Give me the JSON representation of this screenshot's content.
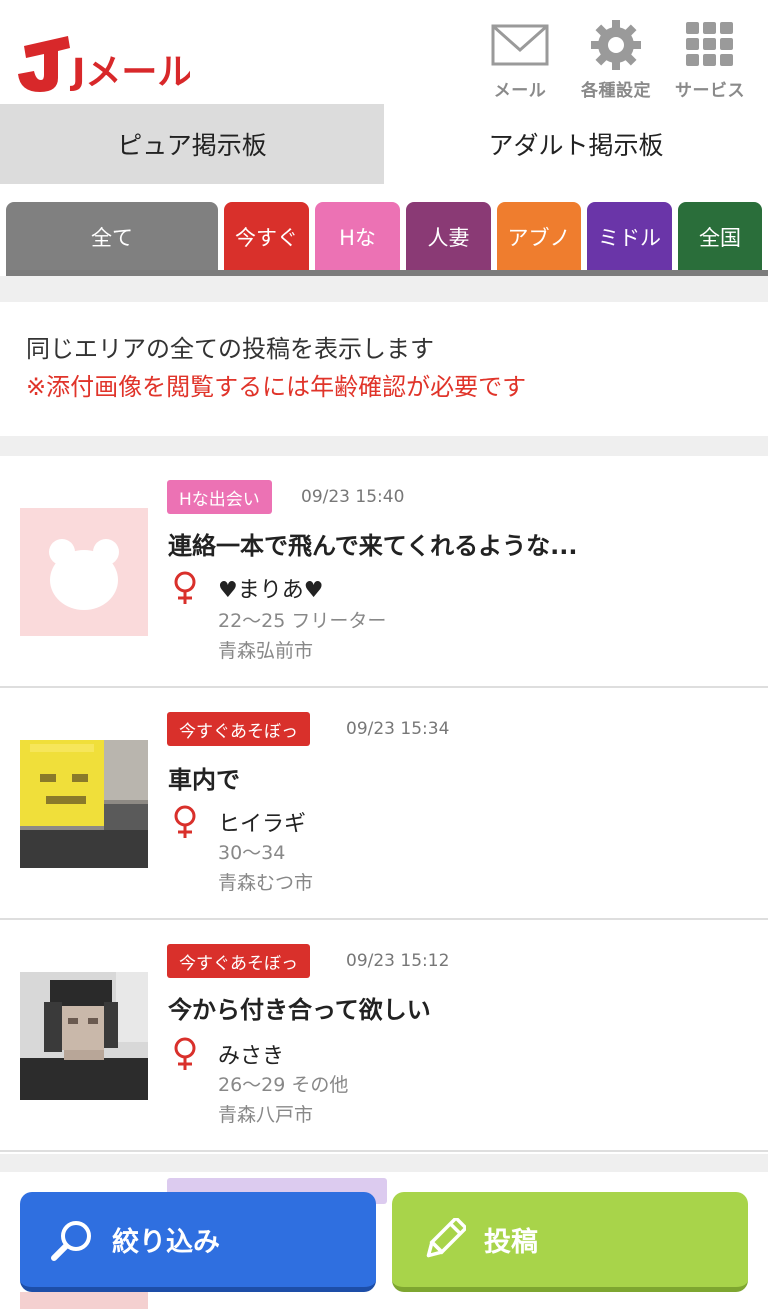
{
  "header": {
    "logo_text": "Jメール",
    "icons": [
      {
        "name": "mail-icon",
        "label": "メール"
      },
      {
        "name": "gear-icon",
        "label": "各種設定"
      },
      {
        "name": "grid-icon",
        "label": "サービス"
      }
    ]
  },
  "board_tabs": [
    {
      "label": "ピュア掲示板",
      "active": true
    },
    {
      "label": "アダルト掲示板",
      "active": false
    }
  ],
  "categories": [
    {
      "label": "全て",
      "color": "#808080"
    },
    {
      "label": "今すぐ",
      "color": "#d9302b"
    },
    {
      "label": "Hな",
      "color": "#ec72b4"
    },
    {
      "label": "人妻",
      "color": "#8a3a75"
    },
    {
      "label": "アブノ",
      "color": "#ef7d2e"
    },
    {
      "label": "ミドル",
      "color": "#6a35a8"
    },
    {
      "label": "全国",
      "color": "#2a6e3a"
    }
  ],
  "info": {
    "line1": "同じエリアの全ての投稿を表示します",
    "line2": "※添付画像を閲覧するには年齢確認が必要です"
  },
  "posts": [
    {
      "badge": "Hな出会い",
      "badge_color": "#ec72b4",
      "datetime": "09/23 15:40",
      "title": "連絡一本で飛んで来てくれるような...",
      "user": "♥まりあ♥",
      "age_job": "22〜25 フリーター",
      "location": "青森弘前市"
    },
    {
      "badge": "今すぐあそぼっ",
      "badge_color": "#d9302b",
      "datetime": "09/23 15:34",
      "title": "車内で",
      "user": "ヒイラギ",
      "age_job": "30〜34",
      "location": "青森むつ市"
    },
    {
      "badge": "今すぐあそぼっ",
      "badge_color": "#d9302b",
      "datetime": "09/23 15:12",
      "title": "今から付き合って欲しい",
      "user": "みさき",
      "age_job": "26〜29 その他",
      "location": "青森八戸市"
    }
  ],
  "bottom": {
    "filter_label": "絞り込み",
    "post_label": "投稿"
  }
}
